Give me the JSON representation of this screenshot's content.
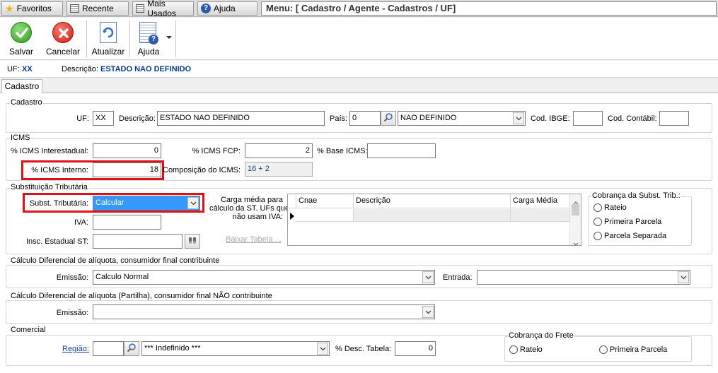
{
  "topnav": {
    "favoritos": "Favoritos",
    "recente": "Recente",
    "mais_usados": "Mais Usados",
    "ajuda": "Ajuda",
    "menu_path": "Menu: [ Cadastro / Agente - Cadastros / UF]"
  },
  "toolbar": {
    "salvar": "Salvar",
    "cancelar": "Cancelar",
    "atualizar": "Atualizar",
    "ajuda": "Ajuda"
  },
  "info": {
    "uf_label": "UF:",
    "uf_value": "XX",
    "descricao_label": "Descrição:",
    "descricao_value": "ESTADO NAO DEFINIDO"
  },
  "tabs": {
    "cadastro": "Cadastro"
  },
  "cadastro": {
    "title": "Cadastro",
    "uf_label": "UF:",
    "uf_value": "XX",
    "descricao_label": "Descrição:",
    "descricao_value": "ESTADO NAO DEFINIDO",
    "pais_label": "País:",
    "pais_code": "0",
    "pais_name": "NAO DEFINIDO",
    "ibge_label": "Cod. IBGE:",
    "ibge_value": "",
    "contabil_label": "Cod. Contábil:",
    "contabil_value": ""
  },
  "icms": {
    "title": "ICMS",
    "interestadual_label": "% ICMS Interestadual:",
    "interestadual_value": "0",
    "fcp_label": "% ICMS FCP:",
    "fcp_value": "2",
    "base_label": "% Base ICMS:",
    "base_value": "",
    "interno_label": "% ICMS Interno:",
    "interno_value": "18",
    "composicao_label": "Composição do ICMS:",
    "composicao_value": "16 + 2",
    "highlight_color": "#e0101a"
  },
  "st": {
    "title": "Substituição Tributária",
    "subst_label": "Subst. Tributária:",
    "subst_value": "Calcular",
    "iva_label": "IVA:",
    "iva_value": "",
    "insc_label": "Insc. Estadual ST:",
    "insc_value": "",
    "carga_label_1": "Carga média para",
    "carga_label_2": "cálculo da ST. UFs que",
    "carga_label_3": "não usam IVA:",
    "baixar_link": "Baixar Tabela ...",
    "grid_headers": [
      "Cnae",
      "Descrição",
      "Carga Média"
    ],
    "cobranca_title": "Cobrança da Subst. Trib.:",
    "cobranca_options": [
      "Rateio",
      "Primeira Parcela",
      "Parcela Separada"
    ],
    "selected_color": "#3399ff"
  },
  "difal": {
    "title": "Cálculo Diferencial de alíquota, consumidor final contribuinte",
    "emissao_label": "Emissão:",
    "emissao_value": "Calculo Normal",
    "entrada_label": "Entrada:",
    "entrada_value": ""
  },
  "partilha": {
    "title": "Cálculo Diferencial de alíquota (Partilha), consumidor final NÃO contribuinte",
    "emissao_label": "Emissão:",
    "emissao_value": ""
  },
  "comercial": {
    "title": "Comercial",
    "regiao_link": "Região:",
    "regiao_code": "",
    "regiao_name": "*** Indefinido ***",
    "desc_label": "% Desc. Tabela:",
    "desc_value": "0",
    "frete_title": "Cobrança do Frete",
    "frete_options": [
      "Rateio",
      "Primeira Parcela"
    ]
  }
}
